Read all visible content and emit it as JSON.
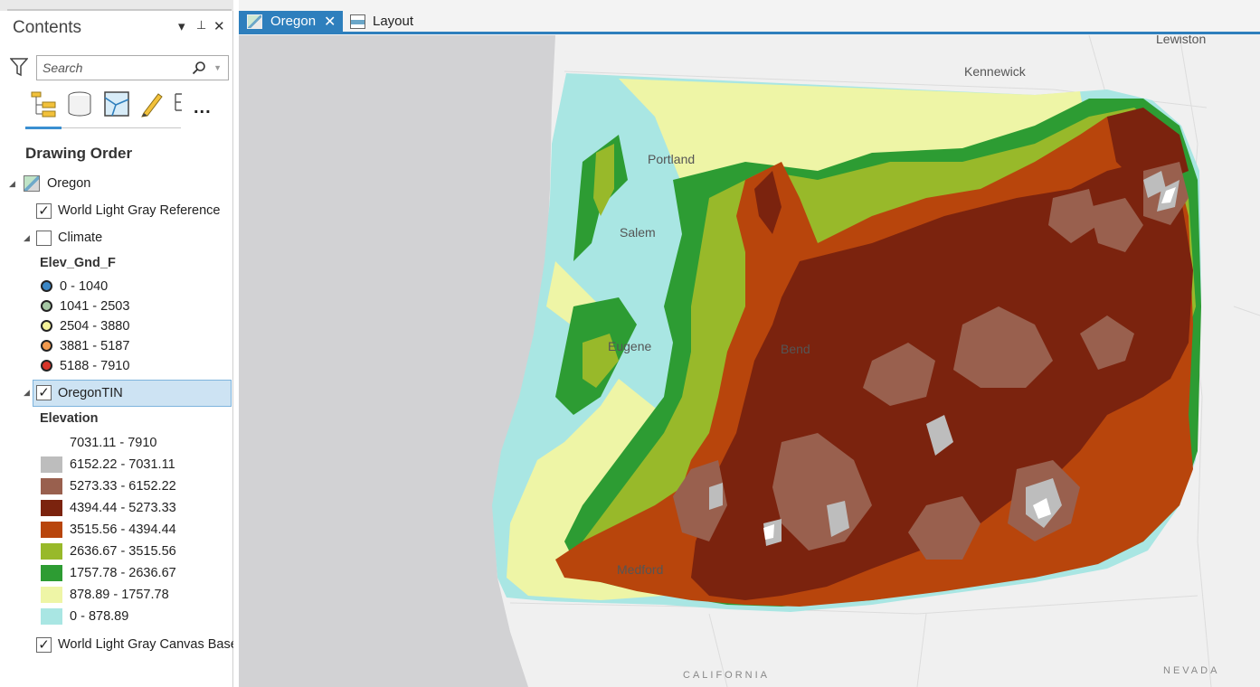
{
  "contents": {
    "title": "Contents",
    "ctrl_menu": "▾",
    "ctrl_pin": "⊥",
    "ctrl_close": "✕",
    "search": {
      "placeholder": "Search"
    },
    "tools": [
      "list-by-drawing-order-icon",
      "list-by-data-source-icon",
      "list-by-selection-icon",
      "list-by-editing-icon",
      "list-by-snapping-icon"
    ],
    "more_label": "...",
    "section_title": "Drawing Order",
    "map_item": {
      "label": "Oregon"
    },
    "world_light_gray_reference": {
      "label": "World Light Gray Reference",
      "checked": true
    },
    "climate": {
      "label": "Climate",
      "checked": false,
      "field": "Elev_Gnd_F",
      "classes": [
        {
          "label": "0 - 1040",
          "color": "#3b87c6"
        },
        {
          "label": "1041 - 2503",
          "color": "#a6c8a4"
        },
        {
          "label": "2504 - 3880",
          "color": "#f4f29a"
        },
        {
          "label": "3881 - 5187",
          "color": "#f39a4e"
        },
        {
          "label": "5188 - 7910",
          "color": "#d8352a"
        }
      ]
    },
    "tin": {
      "label": "OregonTIN",
      "checked": true,
      "field": "Elevation",
      "classes": [
        {
          "label": "7031.11 - 7910",
          "color": "#ffffff"
        },
        {
          "label": "6152.22 - 7031.11",
          "color": "#bdbdbd"
        },
        {
          "label": "5273.33 - 6152.22",
          "color": "#99604e"
        },
        {
          "label": "4394.44 - 5273.33",
          "color": "#7b230e"
        },
        {
          "label": "3515.56 - 4394.44",
          "color": "#b8450c"
        },
        {
          "label": "2636.67 - 3515.56",
          "color": "#98b92a"
        },
        {
          "label": "1757.78 - 2636.67",
          "color": "#2d9c33"
        },
        {
          "label": "878.89 - 1757.78",
          "color": "#eef5a6"
        },
        {
          "label": "0 - 878.89",
          "color": "#a9e6e3"
        }
      ]
    },
    "world_light_gray_canvas_base": {
      "label": "World Light Gray Canvas Base",
      "checked": true
    }
  },
  "tabs": [
    {
      "label": "Oregon",
      "close": "✕",
      "active": true
    },
    {
      "label": "Layout",
      "active": false
    }
  ],
  "map": {
    "cities": {
      "lewiston": "Lewiston",
      "kennewick": "Kennewick",
      "portland": "Portland",
      "salem": "Salem",
      "eugene": "Eugene",
      "bend": "Bend",
      "medford": "Medford"
    },
    "regions": {
      "california": "CALIFORNIA",
      "nevada": "NEVADA"
    }
  }
}
